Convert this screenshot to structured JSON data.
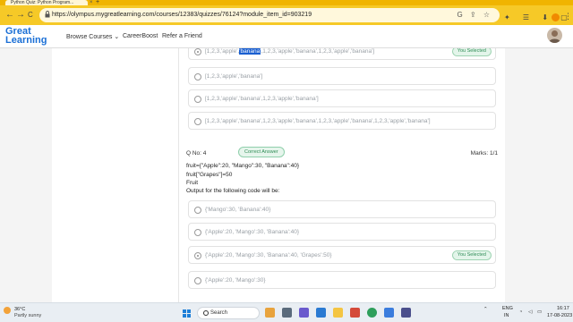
{
  "browser": {
    "tab_title": "Python Quiz: Python Program...",
    "tab_close": "×",
    "new_tab": "+",
    "url": "https://olympus.mygreatlearning.com/courses/12383/quizzes/76124?module_item_id=903219",
    "back": "←",
    "forward": "→",
    "reload": "C",
    "omnibox_icons": "G ⇪ ☆",
    "extension_icons": "✦ ☰ ⬇ ▢",
    "menu": "⋮"
  },
  "site": {
    "logo_line1": "Great",
    "logo_line2": "Learning",
    "nav": [
      "Browse Courses",
      "CareerBoost",
      "Refer a Friend"
    ],
    "nav_caret": "⌄"
  },
  "question3": {
    "options": [
      {
        "text_before": "[1,2,3,'apple',",
        "highlight": "'banana'",
        "text_after": ",1,2,3,'apple','banana',1,2,3,'apple','banana']",
        "selected": true
      },
      {
        "text": "[1,2,3,'apple','banana']",
        "selected": false
      },
      {
        "text": "[1,2,3,'apple','banana',1,2,3,'apple','banana']",
        "selected": false
      },
      {
        "text": "[1,2,3,'apple','banana',1,2,3,'apple','banana',1,2,3,'apple','banana',1,2,3,'apple','banana']",
        "selected": false
      }
    ],
    "selected_badge": "You Selected"
  },
  "question4": {
    "number": "Q No: 4",
    "status": "Correct Answer",
    "marks": "Marks: 1/1",
    "code": [
      "fruit={\"Apple\":20, \"Mango\":30, \"Banana\":40}",
      "fruit[\"Grapes\"]=50",
      "Fruit",
      "Output for the following code will be:"
    ],
    "options": [
      {
        "text": "{'Mango':30, 'Banana':40}",
        "selected": false
      },
      {
        "text": "{'Apple':20, 'Mango':30, 'Banana':40}",
        "selected": false
      },
      {
        "text": "{'Apple':20, 'Mango':30, 'Banana':40, 'Grapes':50}",
        "selected": true
      },
      {
        "text": "{'Apple':20, 'Mango':30}",
        "selected": false
      }
    ],
    "selected_badge": "You Selected"
  },
  "taskbar": {
    "weather_temp": "36°C",
    "weather_desc": "Partly sunny",
    "search_label": "Search",
    "lang_top": "ENG",
    "lang_bottom": "IN",
    "time": "16:17",
    "date": "17-08-2023"
  },
  "colors": {
    "accent_yellow": "#f6c927",
    "brand_blue": "#1a6fd6",
    "correct_green": "#2f8c56"
  }
}
